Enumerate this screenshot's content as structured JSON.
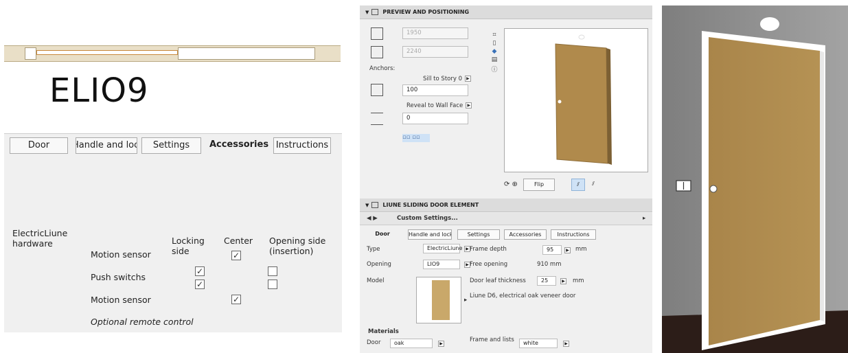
{
  "left": {
    "title": "ELIO9",
    "tabs": [
      "Door",
      "Handle and lock",
      "Settings",
      "Accessories",
      "Instructions"
    ],
    "active_tab": "Accessories",
    "hardware_label": "ElectricLiune hardware",
    "col_locking_side": "Locking side",
    "col_center": "Center",
    "col_opening_side": "Opening side (insertion)",
    "rows": [
      "Motion sensor",
      "Push switchs",
      "Motion sensor"
    ],
    "remote_label": "Optional remote control"
  },
  "middle": {
    "preview_header": "PREVIEW AND POSITIONING",
    "width_value": "1950",
    "height_value": "2240",
    "anchors_label": "Anchors:",
    "sill_label": "Sill to Story 0",
    "sill_value": "100",
    "reveal_label": "Reveal to Wall Face",
    "reveal_value": "0",
    "flip_label": "Flip",
    "element_header": "LIUNE SLIDING DOOR ELEMENT",
    "custom_settings": "Custom Settings...",
    "tabs": [
      "Door",
      "Handle and lock",
      "Settings",
      "Accessories",
      "Instructions"
    ],
    "type_label": "Type",
    "type_value": "ElectricLiune",
    "frame_depth_label": "Frame depth",
    "frame_depth_value": "95",
    "unit_mm": "mm",
    "opening_label": "Opening",
    "opening_value": "LIO9",
    "free_opening_label": "Free opening",
    "free_opening_value": "910 mm",
    "model_label": "Model",
    "leaf_thickness_label": "Door leaf thickness",
    "leaf_thickness_value": "25",
    "model_desc": "Liune D6, electrical oak veneer door",
    "materials_label": "Materials",
    "door_label": "Door",
    "door_material": "oak",
    "frame_label": "Frame and lists",
    "frame_material": "white"
  },
  "colors": {
    "oak": "#b08a4c",
    "wall": "#8c8c8c",
    "floor": "#2c1d18",
    "panel": "#f0f0f0",
    "accent_blue": "#cfe2f6"
  }
}
